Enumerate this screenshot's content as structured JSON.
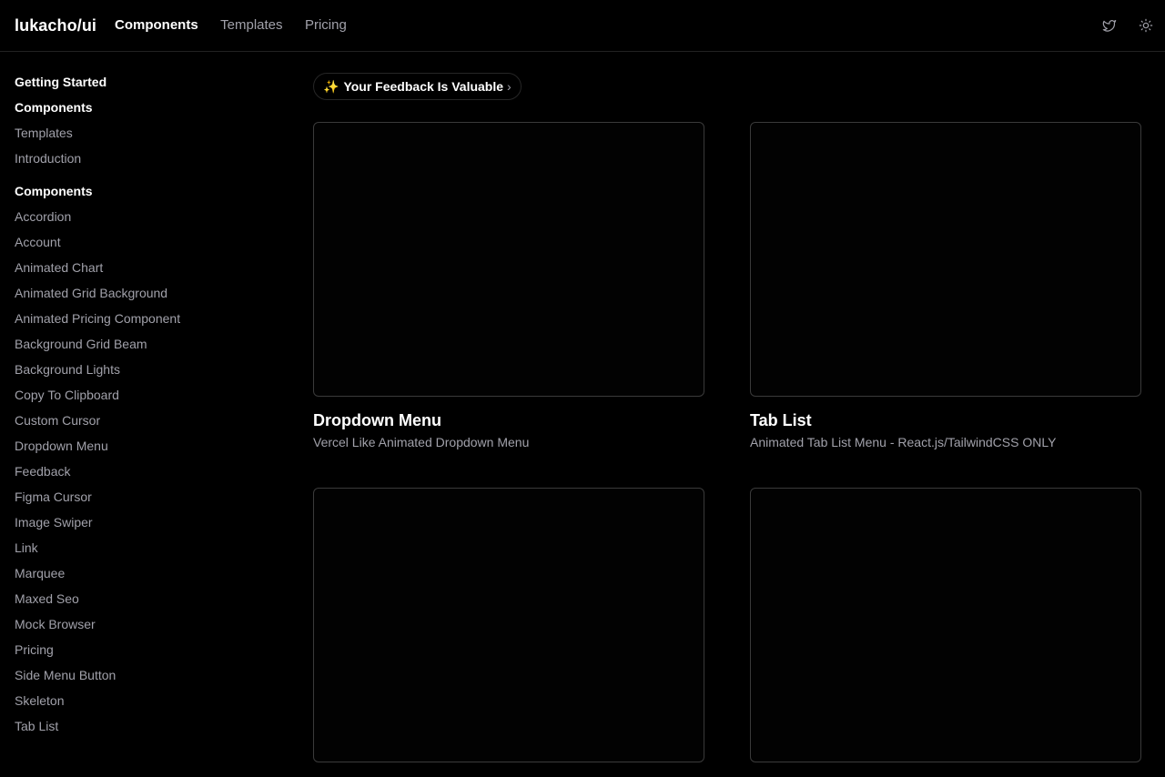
{
  "header": {
    "brand": "lukacho/ui",
    "nav": [
      {
        "label": "Components",
        "active": true
      },
      {
        "label": "Templates",
        "active": false
      },
      {
        "label": "Pricing",
        "active": false
      }
    ],
    "icons": [
      "twitter-icon",
      "sun-icon"
    ]
  },
  "sidebar": {
    "top_links": [
      "Getting Started",
      "Components",
      "Templates",
      "Introduction"
    ],
    "section_heading": "Components",
    "items": [
      "Accordion",
      "Account",
      "Animated Chart",
      "Animated Grid Background",
      "Animated Pricing Component",
      "Background Grid Beam",
      "Background Lights",
      "Copy To Clipboard",
      "Custom Cursor",
      "Dropdown Menu",
      "Feedback",
      "Figma Cursor",
      "Image Swiper",
      "Link",
      "Marquee",
      "Maxed Seo",
      "Mock Browser",
      "Pricing",
      "Side Menu Button",
      "Skeleton",
      "Tab List"
    ]
  },
  "main": {
    "feedback_pill": {
      "spark": "✨",
      "label": "Your Feedback Is Valuable",
      "chevron": "›"
    },
    "cards": [
      {
        "title": "Dropdown Menu",
        "description": "Vercel Like Animated Dropdown Menu"
      },
      {
        "title": "Tab List",
        "description": "Animated Tab List Menu - React.js/TailwindCSS ONLY"
      },
      {
        "title": "",
        "description": ""
      },
      {
        "title": "",
        "description": ""
      }
    ]
  },
  "colors": {
    "background": "#000000",
    "text": "#ffffff",
    "muted": "#a1a1aa",
    "border": "#3a3a3a"
  }
}
